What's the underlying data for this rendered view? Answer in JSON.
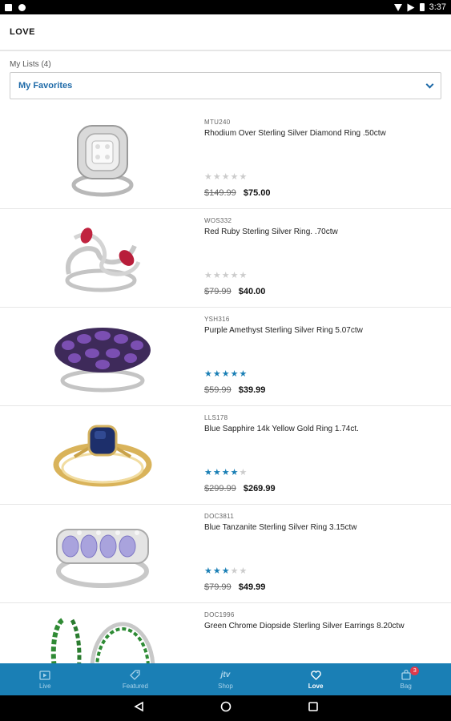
{
  "status_bar": {
    "time": "3:37"
  },
  "app_bar": {
    "title": "LOVE"
  },
  "lists": {
    "label": "My Lists (4)",
    "selected": "My Favorites"
  },
  "colors": {
    "accent": "#1a7fb5",
    "link": "#1e6aa8",
    "star_on": "#1a7fb5",
    "star_off": "#cccccc",
    "badge": "#e03a4b"
  },
  "products": [
    {
      "sku": "MTU240",
      "name": "Rhodium Over Sterling Silver Diamond Ring .50ctw",
      "rating": 0,
      "was": "$149.99",
      "now": "$75.00",
      "image": "diamond-ring"
    },
    {
      "sku": "WOS332",
      "name": "Red Ruby Sterling Silver Ring. .70ctw",
      "rating": 0,
      "was": "$79.99",
      "now": "$40.00",
      "image": "ruby-ring"
    },
    {
      "sku": "YSH316",
      "name": "Purple Amethyst Sterling Silver Ring 5.07ctw",
      "rating": 5,
      "was": "$59.99",
      "now": "$39.99",
      "image": "amethyst-ring"
    },
    {
      "sku": "LLS178",
      "name": "Blue Sapphire 14k Yellow Gold Ring 1.74ct.",
      "rating": 4,
      "was": "$299.99",
      "now": "$269.99",
      "image": "sapphire-ring"
    },
    {
      "sku": "DOC3811",
      "name": "Blue Tanzanite Sterling Silver Ring 3.15ctw",
      "rating": 3,
      "was": "$79.99",
      "now": "$49.99",
      "image": "tanzanite-ring"
    },
    {
      "sku": "DOC1996",
      "name": "Green Chrome Diopside Sterling Silver Earrings 8.20ctw",
      "rating": 0,
      "was": "",
      "now": "",
      "image": "diopside-earrings"
    }
  ],
  "tabs": [
    {
      "label": "Live",
      "icon": "play-icon"
    },
    {
      "label": "Featured",
      "icon": "tag-icon"
    },
    {
      "label": "Shop",
      "icon": "jtv-icon"
    },
    {
      "label": "Love",
      "icon": "heart-icon",
      "active": true
    },
    {
      "label": "Bag",
      "icon": "bag-icon",
      "badge": "3"
    }
  ]
}
